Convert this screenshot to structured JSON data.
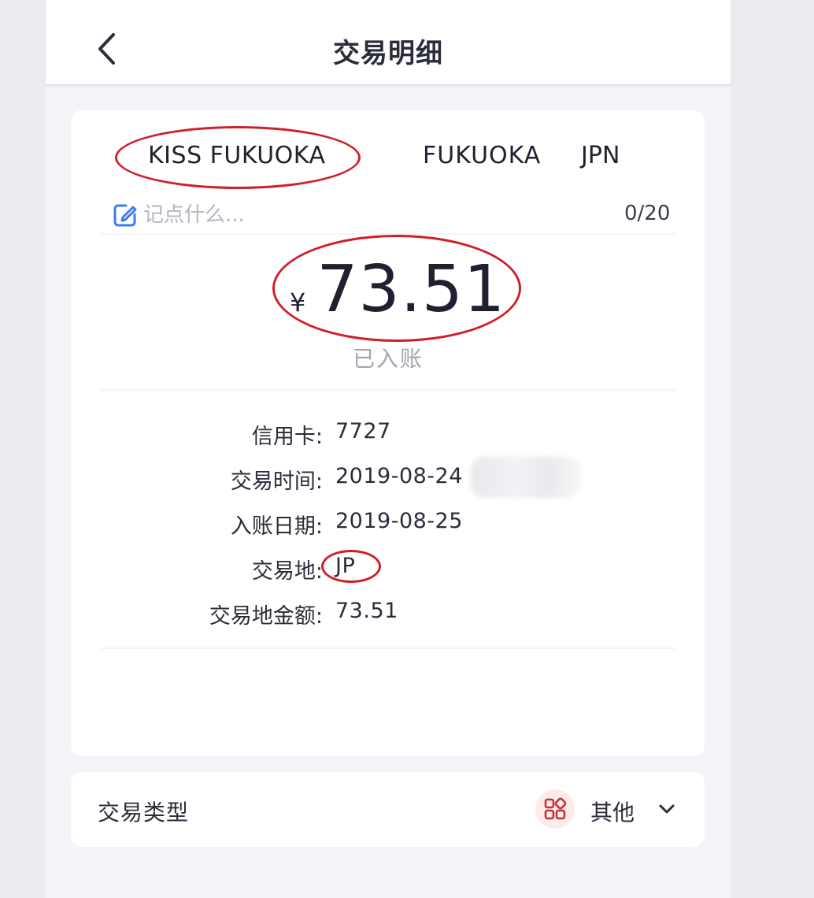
{
  "header": {
    "title": "交易明细"
  },
  "merchant": {
    "name": "KISS FUKUOKA",
    "city": "FUKUOKA",
    "country": "JPN"
  },
  "note": {
    "placeholder": "记点什么...",
    "counter": "0/20"
  },
  "amount": {
    "currency_symbol": "¥",
    "value": "73.51",
    "status": "已入账"
  },
  "details": [
    {
      "label": "信用卡:",
      "value": "7727"
    },
    {
      "label": "交易时间:",
      "value": "2019-08-24"
    },
    {
      "label": "入账日期:",
      "value": "2019-08-25"
    },
    {
      "label": "交易地:",
      "value": "JP"
    },
    {
      "label": "交易地金额:",
      "value": "73.51"
    }
  ],
  "transaction_type": {
    "label": "交易类型",
    "value": "其他",
    "icon": "category-grid-icon"
  },
  "colors": {
    "annotation_ring": "#d11f2a",
    "note_icon": "#3f7ce8",
    "type_icon": "#c3313a"
  }
}
